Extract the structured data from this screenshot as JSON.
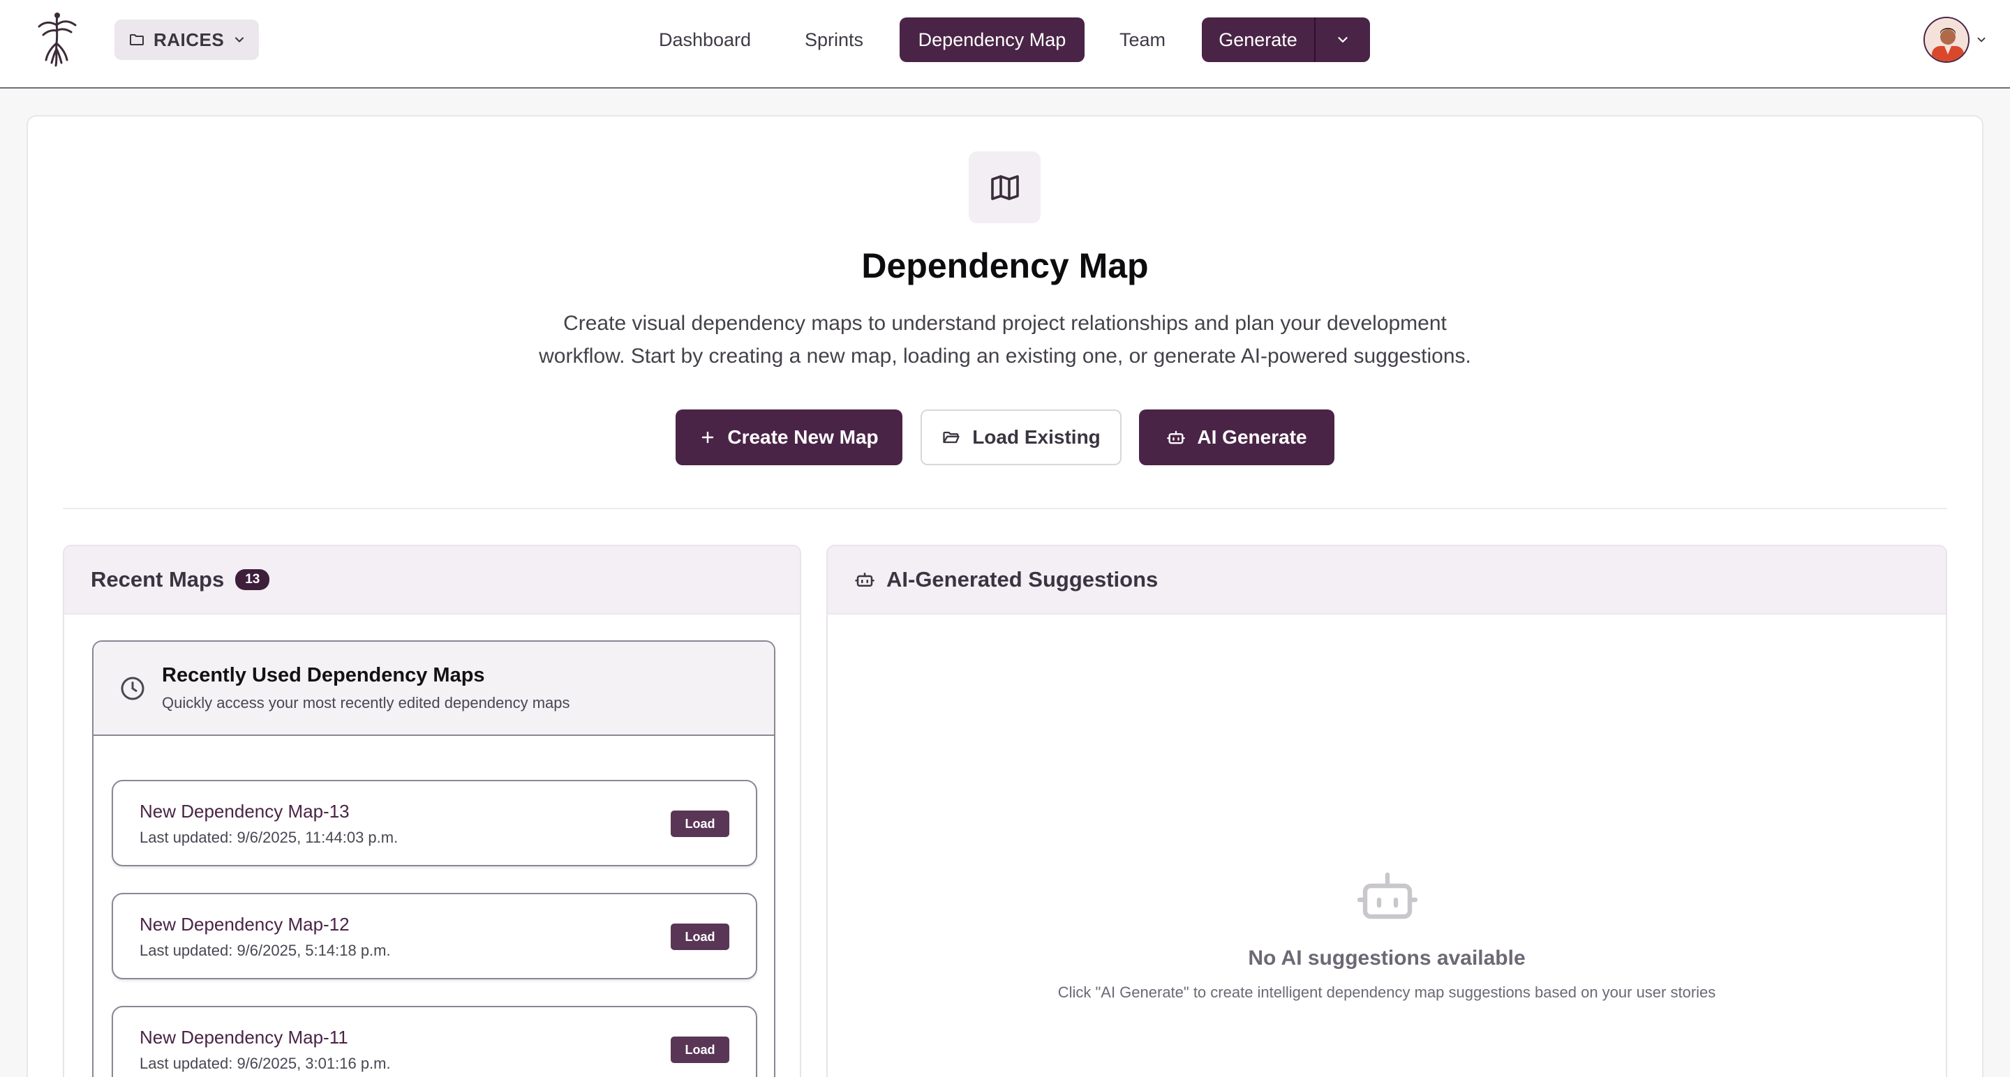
{
  "header": {
    "project_name": "RAICES",
    "nav": [
      {
        "label": "Dashboard",
        "active": false
      },
      {
        "label": "Sprints",
        "active": false
      },
      {
        "label": "Dependency Map",
        "active": true
      },
      {
        "label": "Team",
        "active": false
      }
    ],
    "generate_label": "Generate"
  },
  "hero": {
    "title": "Dependency Map",
    "description_line1": "Create visual dependency maps to understand project relationships and plan your development",
    "description_line2": "workflow. Start by creating a new map, loading an existing one, or generate AI-powered suggestions.",
    "create_label": "Create New Map",
    "load_label": "Load Existing",
    "ai_label": "AI Generate"
  },
  "recent_maps": {
    "title": "Recent Maps",
    "count": "13",
    "card_title": "Recently Used Dependency Maps",
    "card_subtitle": "Quickly access your most recently edited dependency maps",
    "load_label": "Load",
    "items": [
      {
        "name": "New Dependency Map-13",
        "updated": "Last updated: 9/6/2025, 11:44:03 p.m."
      },
      {
        "name": "New Dependency Map-12",
        "updated": "Last updated: 9/6/2025, 5:14:18 p.m."
      },
      {
        "name": "New Dependency Map-11",
        "updated": "Last updated: 9/6/2025, 3:01:16 p.m."
      }
    ]
  },
  "ai_suggestions": {
    "title": "AI-Generated Suggestions",
    "empty_title": "No AI suggestions available",
    "empty_desc": "Click \"AI Generate\" to create intelligent dependency map suggestions based on your user stories"
  },
  "colors": {
    "brand": "#4a2446",
    "background": "#f7f7f8",
    "panel_header": "#f3eff4"
  }
}
